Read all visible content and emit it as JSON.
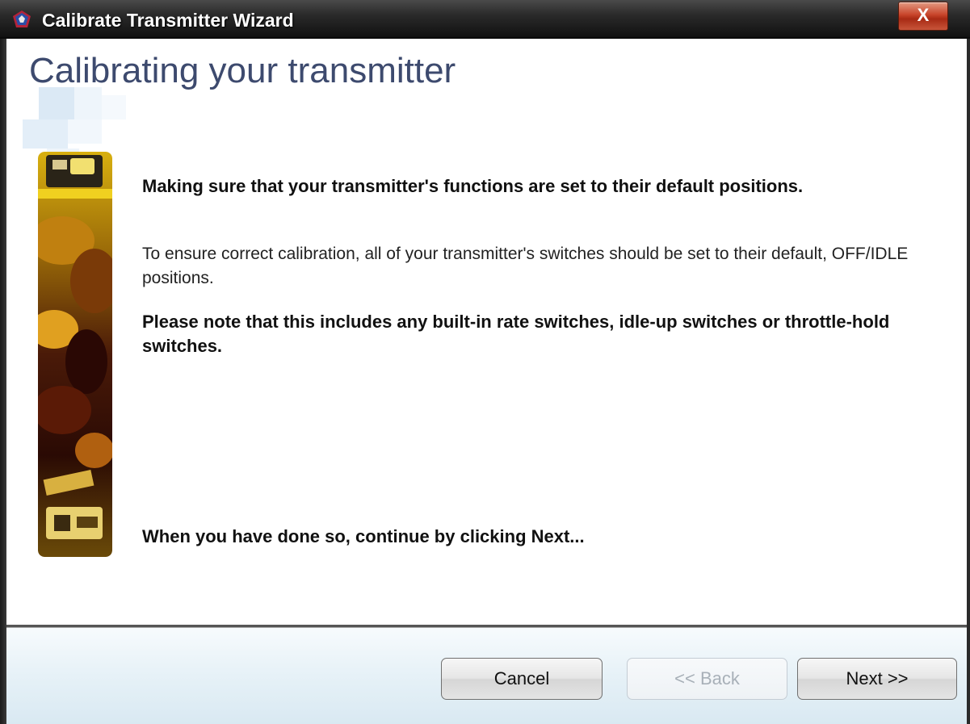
{
  "window": {
    "title": "Calibrate Transmitter Wizard",
    "close_label": "X"
  },
  "page": {
    "heading": "Calibrating your transmitter",
    "title": "Making sure that your transmitter's functions are set to their default positions.",
    "body": "To ensure correct calibration, all of your transmitter's switches should be set to their default, OFF/IDLE positions.",
    "note": "Please note that this includes any built-in rate switches, idle-up switches or throttle-hold switches.",
    "continue_hint": "When you have done so, continue by clicking Next..."
  },
  "footer": {
    "cancel_label": "Cancel",
    "back_label": "<< Back",
    "next_label": "Next >>",
    "back_enabled": false
  },
  "colors": {
    "heading": "#3d4a6e",
    "titlebar": "#1e1e1e",
    "close_button": "#c8442a",
    "footer_bg": "#e6f1f7"
  }
}
